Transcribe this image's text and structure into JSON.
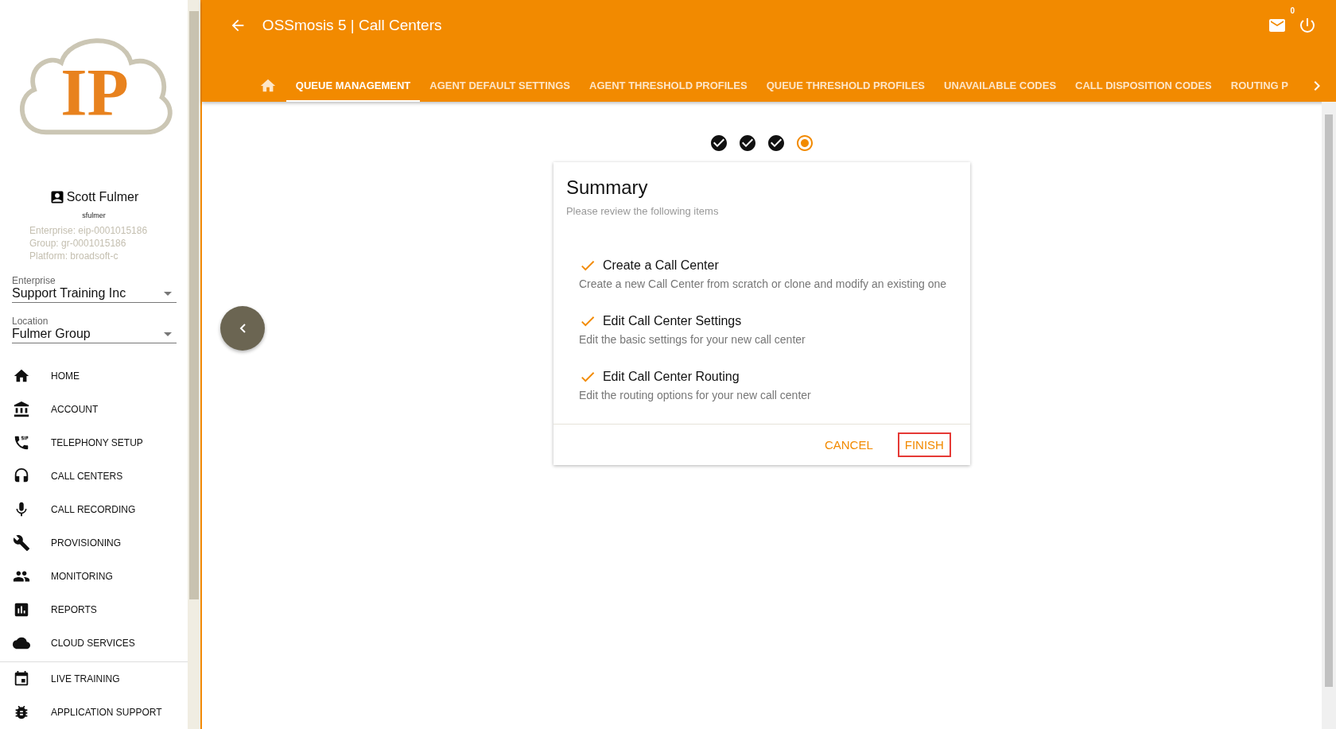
{
  "sidebar": {
    "logo": {
      "text": "IP"
    },
    "user": {
      "name": "Scott Fulmer",
      "username": "sfulmer",
      "details": [
        "Enterprise: eip-0001015186",
        "Group: gr-0001015186",
        "Platform: broadsoft-c"
      ]
    },
    "selects": [
      {
        "label": "Enterprise",
        "value": "Support Training Inc"
      },
      {
        "label": "Location",
        "value": "Fulmer Group"
      }
    ],
    "nav_sections": [
      [
        {
          "label": "HOME"
        },
        {
          "label": "ACCOUNT"
        },
        {
          "label": "TELEPHONY SETUP"
        },
        {
          "label": "CALL CENTERS"
        },
        {
          "label": "CALL RECORDING"
        },
        {
          "label": "PROVISIONING"
        },
        {
          "label": "MONITORING"
        },
        {
          "label": "REPORTS"
        },
        {
          "label": "CLOUD SERVICES"
        }
      ],
      [
        {
          "label": "LIVE TRAINING"
        },
        {
          "label": "APPLICATION SUPPORT"
        }
      ]
    ]
  },
  "header": {
    "title": "OSSmosis 5 | Call Centers",
    "notification_count": "0",
    "tabs": [
      {
        "label": "QUEUE MANAGEMENT",
        "selected": true
      },
      {
        "label": "AGENT DEFAULT SETTINGS",
        "selected": false
      },
      {
        "label": "AGENT THRESHOLD PROFILES",
        "selected": false
      },
      {
        "label": "QUEUE THRESHOLD PROFILES",
        "selected": false
      },
      {
        "label": "UNAVAILABLE CODES",
        "selected": false
      },
      {
        "label": "CALL DISPOSITION CODES",
        "selected": false
      },
      {
        "label": "ROUTING P",
        "selected": false
      }
    ]
  },
  "stepper": [
    {
      "kind": "done"
    },
    {
      "kind": "done"
    },
    {
      "kind": "done"
    },
    {
      "kind": "current"
    }
  ],
  "card": {
    "title": "Summary",
    "subtitle": "Please review the following items",
    "items": [
      {
        "title": "Create a Call Center",
        "description": "Create a new Call Center from scratch or clone and modify an existing one"
      },
      {
        "title": "Edit Call Center Settings",
        "description": "Edit the basic settings for your new call center"
      },
      {
        "title": "Edit Call Center Routing",
        "description": "Edit the routing options for your new call center"
      }
    ],
    "buttons": [
      {
        "label": "CANCEL",
        "highlighted": false
      },
      {
        "label": "FINISH",
        "highlighted": true
      }
    ]
  }
}
